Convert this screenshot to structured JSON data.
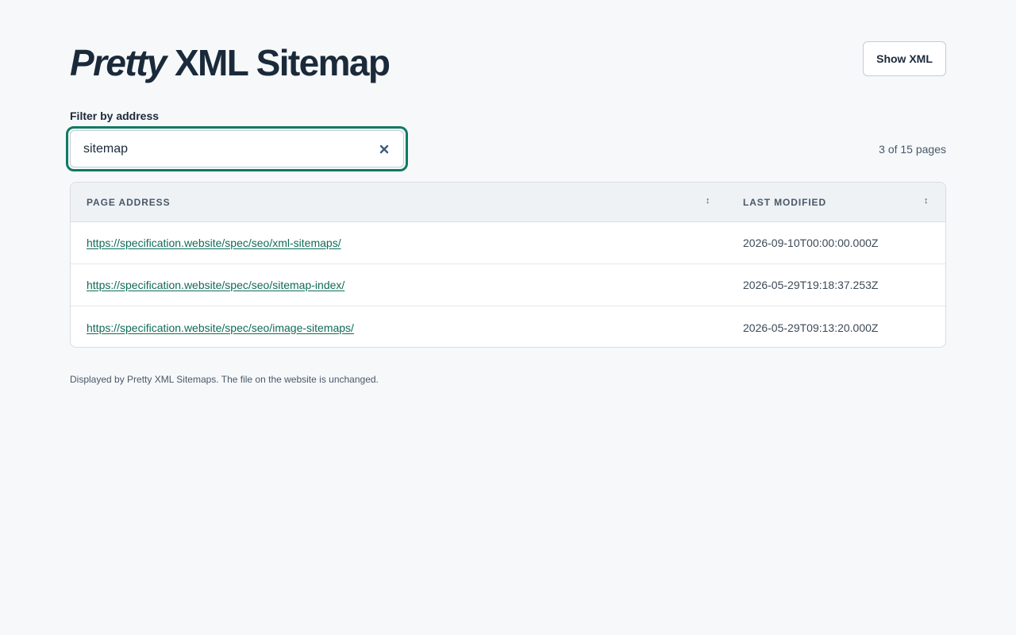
{
  "header": {
    "title_italic": "Pretty",
    "title_rest": " XML Sitemap",
    "show_xml_label": "Show XML"
  },
  "filter": {
    "label": "Filter by address",
    "value": "sitemap",
    "clear_icon": "close-icon"
  },
  "result_count": "3 of 15 pages",
  "table": {
    "columns": [
      {
        "label": "PAGE ADDRESS",
        "sort_icon": "sort-icon"
      },
      {
        "label": "LAST MODIFIED",
        "sort_icon": "sort-icon"
      }
    ],
    "rows": [
      {
        "url": "https://specification.website/spec/seo/xml-sitemaps/",
        "lastmod": "2026-09-10T00:00:00.000Z"
      },
      {
        "url": "https://specification.website/spec/seo/sitemap-index/",
        "lastmod": "2026-05-29T19:18:37.253Z"
      },
      {
        "url": "https://specification.website/spec/seo/image-sitemaps/",
        "lastmod": "2026-05-29T09:13:20.000Z"
      }
    ]
  },
  "footer": "Displayed by Pretty XML Sitemaps. The file on the website is unchanged.",
  "colors": {
    "accent": "#0f7a63",
    "link": "#0f6b56",
    "background": "#f6f8fa",
    "heading": "#1b2a3a"
  }
}
